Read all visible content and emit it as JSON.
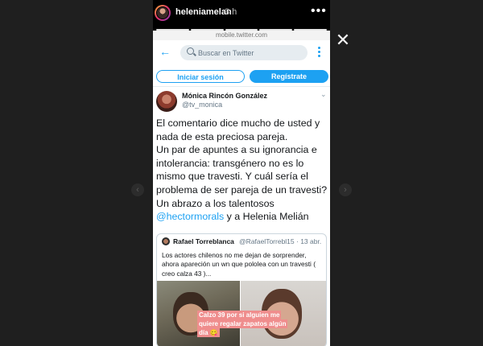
{
  "story": {
    "username": "heleniamelan",
    "time": "3 h",
    "more_glyph": "•••",
    "close_glyph": "✕",
    "progress_segments": 5,
    "url": "mobile.twitter.com",
    "prev_glyph": "‹",
    "next_glyph": "›"
  },
  "twitter": {
    "back_glyph": "←",
    "search_placeholder": "Buscar en Twitter",
    "login_label": "Iniciar sesión",
    "register_label": "Regístrate",
    "accent": "#1da1f2",
    "tweet": {
      "author_name": "Mónica Rincón González",
      "author_handle": "@tv_monica",
      "chevron": "⌄",
      "paragraph1": "El comentario dice mucho de usted y nada de esta preciosa pareja.",
      "paragraph2": "Un par de apuntes a su ignorancia e intolerancia: transgénero no es lo mismo que travesti. Y cuál sería el problema de ser pareja de un travesti?",
      "paragraph3": "Un abrazo a los talentosos",
      "mention": "@hectormorals",
      "paragraph3_end": " y a Helenia Melián"
    },
    "quote": {
      "name": "Rafael Torreblanca",
      "handle_date": "@RafaelTorrebl15 · 13 abr.",
      "text": "Los actores chilenos no me dejan de sorprender, ahora apareción un wn que pololea con un travesti ( creo calza 43 )...",
      "caption": "Calzo 39 por si alguien me quiere regalar zapatos algún día 😋"
    }
  },
  "colors": {
    "backdrop": "#1d1d1d",
    "caption_bg": "#ef8d8d"
  }
}
